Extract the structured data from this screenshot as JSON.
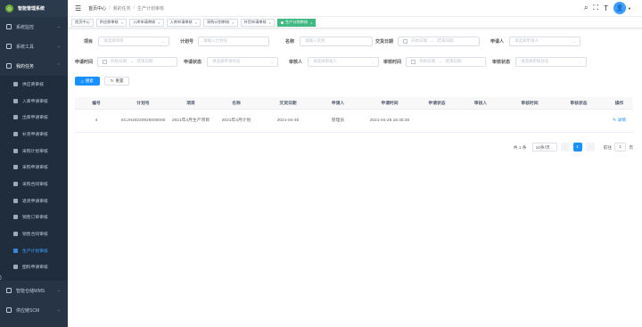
{
  "brand": {
    "logo_glyph": "◎",
    "name": "智能管理系统"
  },
  "sidebar": {
    "groups": [
      {
        "label": "系统监控"
      },
      {
        "label": "系统工具"
      },
      {
        "label": "我的任务"
      }
    ],
    "sub_items": [
      {
        "label": "供应商审核"
      },
      {
        "label": "入库申请审核"
      },
      {
        "label": "出库申请审核"
      },
      {
        "label": "补货申请审核"
      },
      {
        "label": "采购计划审核"
      },
      {
        "label": "采购申请审核"
      },
      {
        "label": "采购合同审核"
      },
      {
        "label": "退货申请审核"
      },
      {
        "label": "销售订单审核"
      },
      {
        "label": "销售合同审核"
      },
      {
        "label": "生产计划审核"
      },
      {
        "label": "图料申请审核"
      }
    ],
    "bottom_groups": [
      {
        "label": "智能仓储WMS"
      },
      {
        "label": "供应链SCM"
      }
    ]
  },
  "header": {
    "hamburger": "☰",
    "breadcrumb": [
      "首页中心",
      "我的任务",
      "生产计划审核"
    ],
    "breadcrumb_sep": "/",
    "tools": {
      "search": "⌕",
      "fullscreen": "⛶",
      "font_size": "T"
    },
    "avatar_glyph": "👤"
  },
  "tags": [
    {
      "label": "首页中心",
      "active": false
    },
    {
      "label": "供应商审核",
      "active": false
    },
    {
      "label": "入库申请审核",
      "active": false
    },
    {
      "label": "入库申请审核",
      "active": false
    },
    {
      "label": "采购计划审核",
      "active": false
    },
    {
      "label": "补货申请审核",
      "active": false
    },
    {
      "label": "生产计划审核",
      "active": true
    }
  ],
  "filters": {
    "project": {
      "label": "项目",
      "placeholder": "请选择项目"
    },
    "plan_no": {
      "label": "计划号",
      "placeholder": "请输入计划号"
    },
    "name": {
      "label": "名称",
      "placeholder": "请输入名称"
    },
    "delivery_date": {
      "label": "交货日期",
      "start": "开始日期",
      "end": "结束日期"
    },
    "applicant": {
      "label": "申请人",
      "placeholder": "请选择申请人"
    },
    "apply_time": {
      "label": "申请时间",
      "start": "开始日期",
      "end": "结束日期"
    },
    "apply_status": {
      "label": "申请状态",
      "placeholder": "请选择申请状态"
    },
    "reviewer": {
      "label": "审核人",
      "placeholder": "请选择审核人"
    },
    "review_time": {
      "label": "审核时间",
      "start": "开始日期",
      "end": "结束日期"
    },
    "review_status": {
      "label": "审核状态",
      "placeholder": "请选择审核状态"
    },
    "range_sep": "-",
    "search_button": "搜索",
    "reset_button": "重置"
  },
  "table": {
    "columns": [
      "编号",
      "计划号",
      "项目",
      "名称",
      "交货日期",
      "申请人",
      "申请时间",
      "申请状态",
      "审核人",
      "审核时间",
      "审核状态",
      "操作"
    ],
    "rows": [
      {
        "id": "4",
        "plan_no": "SCJH20220925000000",
        "project": "2021年4月生产项目",
        "name": "2021年4月计划",
        "delivery_date": "2021-04-30",
        "applicant": "管理员",
        "apply_time": "2021-04-28 16:45:30",
        "apply_status": "",
        "reviewer": "",
        "review_time": "",
        "review_status": "",
        "action": "✎ 详情"
      }
    ]
  },
  "pagination": {
    "total": "共 1 条",
    "page_size": "10条/页",
    "prev": "‹",
    "current": "1",
    "next": "›",
    "goto_label": "前往",
    "goto_value": "1",
    "goto_suffix": "页"
  },
  "colors": {
    "sidebar_bg": "#263445",
    "active_tag": "#42b983",
    "primary": "#1890ff",
    "active_menu": "#409eff"
  }
}
